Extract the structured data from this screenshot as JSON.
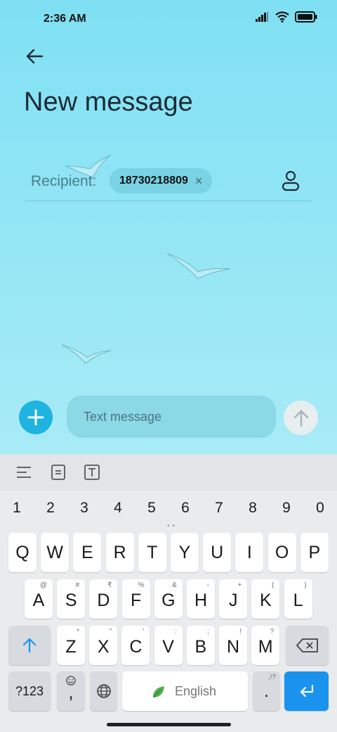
{
  "status": {
    "time": "2:36 AM"
  },
  "header": {
    "title": "New message"
  },
  "recipient": {
    "label": "Recipient:",
    "chip": "18730218809",
    "chip_remove": "×"
  },
  "composer": {
    "placeholder": "Text message",
    "add": "+"
  },
  "keyboard": {
    "numbers": [
      "1",
      "2",
      "3",
      "4",
      "5",
      "6",
      "7",
      "8",
      "9",
      "0"
    ],
    "row1": [
      "Q",
      "W",
      "E",
      "R",
      "T",
      "Y",
      "U",
      "I",
      "O",
      "P"
    ],
    "row2": [
      {
        "key": "A",
        "sup": "@"
      },
      {
        "key": "S",
        "sup": "#"
      },
      {
        "key": "D",
        "sup": "₹"
      },
      {
        "key": "F",
        "sup": "%"
      },
      {
        "key": "G",
        "sup": "&"
      },
      {
        "key": "H",
        "sup": "-"
      },
      {
        "key": "J",
        "sup": "+"
      },
      {
        "key": "K",
        "sup": "("
      },
      {
        "key": "L",
        "sup": ")"
      }
    ],
    "row3": [
      {
        "key": "Z",
        "sup": "*"
      },
      {
        "key": "X",
        "sup": "\""
      },
      {
        "key": "C",
        "sup": "'"
      },
      {
        "key": "V",
        "sup": ":"
      },
      {
        "key": "B",
        "sup": ";"
      },
      {
        "key": "N",
        "sup": "!"
      },
      {
        "key": "M",
        "sup": "?"
      }
    ],
    "symbols": "?123",
    "comma": ",",
    "space": "English",
    "period": ".",
    "period_sup": ",!?"
  },
  "colors": {
    "accent": "#1fb3e0",
    "enter": "#1a93ef"
  },
  "icons": [
    "back-arrow-icon",
    "contact-icon",
    "plus-icon",
    "send-arrow-icon",
    "shift-icon",
    "backspace-icon",
    "globe-icon",
    "emoji-icon",
    "enter-icon",
    "leaf-icon",
    "signal-icon",
    "wifi-icon",
    "battery-icon"
  ]
}
